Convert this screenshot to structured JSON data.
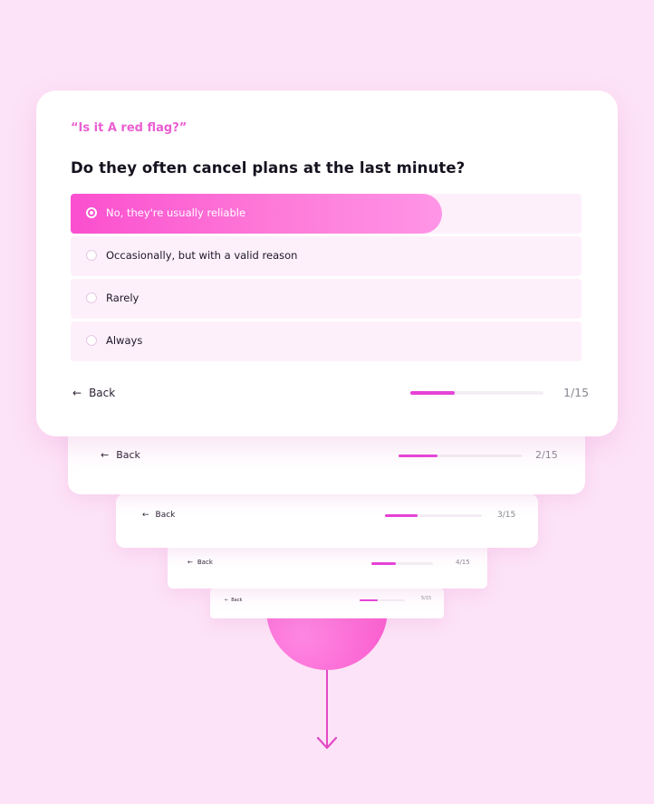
{
  "quiz": {
    "eyebrow": "“Is it A red flag?”",
    "question": "Do they often cancel plans at the last minute?",
    "options": [
      {
        "label": "No, they're usually reliable",
        "selected": true
      },
      {
        "label": "Occasionally, but with a valid reason",
        "selected": false
      },
      {
        "label": "Rarely",
        "selected": false
      },
      {
        "label": "Always",
        "selected": false
      }
    ],
    "back_label": "Back",
    "progress_text": "1/15",
    "progress_fraction": 0.33
  },
  "stacked_cards": [
    {
      "back_label": "Back",
      "progress_text": "2/15"
    },
    {
      "back_label": "Back",
      "progress_text": "3/15"
    },
    {
      "back_label": "Back",
      "progress_text": "4/15"
    },
    {
      "back_label": "Back",
      "progress_text": "5/15"
    }
  ],
  "icons": {
    "back": "arrow-left-icon",
    "down": "arrow-down-icon"
  },
  "colors": {
    "accent": "#fb4fcf",
    "background": "#fde3f7",
    "eyebrow": "#ea5fd2"
  }
}
